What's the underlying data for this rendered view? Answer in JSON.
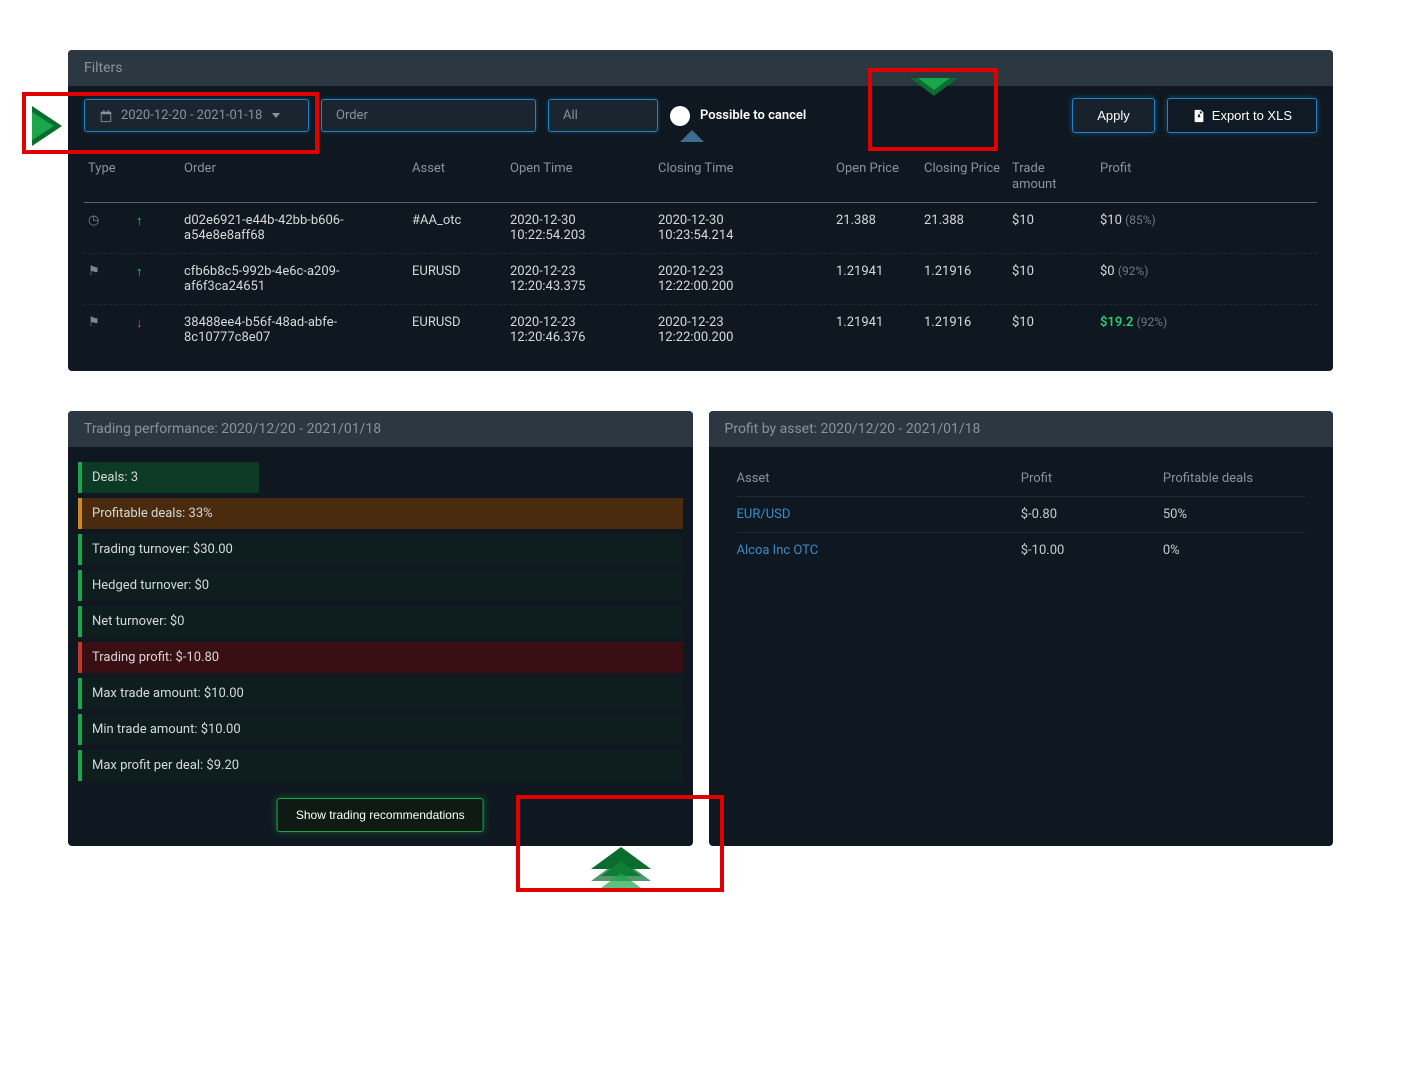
{
  "filters": {
    "header": "Filters",
    "date_range": "2020-12-20 - 2021-01-18",
    "order_placeholder": "Order",
    "all_label": "All",
    "cancel_label": "Possible to cancel",
    "apply_label": "Apply",
    "export_label": "Export to XLS"
  },
  "table": {
    "headers": {
      "type": "Type",
      "order": "Order",
      "asset": "Asset",
      "open_time": "Open Time",
      "closing_time": "Closing Time",
      "open_price": "Open Price",
      "closing_price": "Closing Price",
      "trade_amount": "Trade amount",
      "profit": "Profit"
    },
    "rows": [
      {
        "type_icon": "clock",
        "dir": "up",
        "order": "d02e6921-e44b-42bb-b606-a54e8e8aff68",
        "asset": "#AA_otc",
        "open_time": "2020-12-30 10:22:54.203",
        "closing_time": "2020-12-30 10:23:54.214",
        "open_price": "21.388",
        "closing_price": "21.388",
        "amount": "$10",
        "profit": "$10",
        "pct": "(85%)",
        "profit_green": false
      },
      {
        "type_icon": "flag",
        "dir": "up",
        "order": "cfb6b8c5-992b-4e6c-a209-af6f3ca24651",
        "asset": "EURUSD",
        "open_time": "2020-12-23 12:20:43.375",
        "closing_time": "2020-12-23 12:22:00.200",
        "open_price": "1.21941",
        "closing_price": "1.21916",
        "amount": "$10",
        "profit": "$0",
        "pct": "(92%)",
        "profit_green": false
      },
      {
        "type_icon": "flag",
        "dir": "down",
        "order": "38488ee4-b56f-48ad-abfe-8c10777c8e07",
        "asset": "EURUSD",
        "open_time": "2020-12-23 12:20:46.376",
        "closing_time": "2020-12-23 12:22:00.200",
        "open_price": "1.21941",
        "closing_price": "1.21916",
        "amount": "$10",
        "profit": "$19.2",
        "pct": "(92%)",
        "profit_green": true
      }
    ]
  },
  "performance": {
    "title": "Trading performance: 2020/12/20 - 2021/01/18",
    "items": [
      {
        "text": "Deals: 3",
        "level": "green",
        "shade": "none"
      },
      {
        "text": "Profitable deals: 33%",
        "level": "orange",
        "shade": "orange"
      },
      {
        "text": "Trading turnover: $30.00",
        "level": "green",
        "shade": "none"
      },
      {
        "text": "Hedged turnover: $0",
        "level": "green",
        "shade": "none"
      },
      {
        "text": "Net turnover: $0",
        "level": "green",
        "shade": "none"
      },
      {
        "text": "Trading profit: $-10.80",
        "level": "red",
        "shade": "red"
      },
      {
        "text": "Max trade amount: $10.00",
        "level": "green",
        "shade": "none"
      },
      {
        "text": "Min trade amount: $10.00",
        "level": "green",
        "shade": "none"
      },
      {
        "text": "Max profit per deal: $9.20",
        "level": "green",
        "shade": "none"
      }
    ],
    "reco_button": "Show trading recommendations"
  },
  "profit_asset": {
    "title": "Profit by asset: 2020/12/20 - 2021/01/18",
    "headers": {
      "asset": "Asset",
      "profit": "Profit",
      "deals": "Profitable deals"
    },
    "rows": [
      {
        "asset": "EUR/USD",
        "profit": "$-0.80",
        "deals": "50%"
      },
      {
        "asset": "Alcoa Inc OTC",
        "profit": "$-10.00",
        "deals": "0%"
      }
    ]
  }
}
